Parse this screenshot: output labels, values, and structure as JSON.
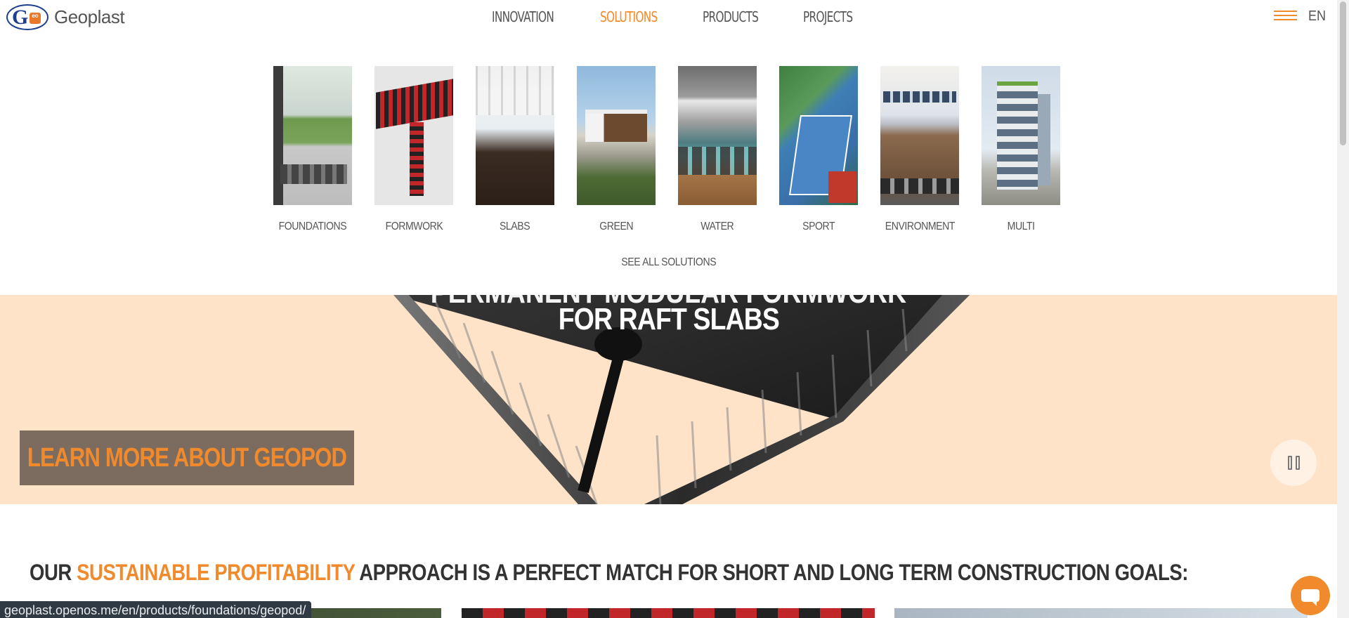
{
  "brand": {
    "name": "Geoplast",
    "logo_letters": "G",
    "logo_badge": "eo"
  },
  "nav": {
    "items": [
      {
        "label": "INNOVATION",
        "active": false
      },
      {
        "label": "SOLUTIONS",
        "active": true
      },
      {
        "label": "PRODUCTS",
        "active": false
      },
      {
        "label": "PROJECTS",
        "active": false
      }
    ],
    "language": "EN"
  },
  "solutions_menu": {
    "items": [
      {
        "label": "FOUNDATIONS"
      },
      {
        "label": "FORMWORK"
      },
      {
        "label": "SLABS"
      },
      {
        "label": "GREEN"
      },
      {
        "label": "WATER"
      },
      {
        "label": "SPORT"
      },
      {
        "label": "ENVIRONMENT"
      },
      {
        "label": "MULTI"
      }
    ],
    "see_all": "SEE ALL SOLUTIONS"
  },
  "hero": {
    "title_line_hidden": "PERMANENT MODULAR FORMWORK",
    "title_line": "FOR RAFT SLABS",
    "cta_label": "LEARN MORE ABOUT GEOPOD"
  },
  "tagline": {
    "prefix": "OUR ",
    "highlight": "SUSTAINABLE PROFITABILITY",
    "suffix": " APPROACH IS A PERFECT MATCH FOR SHORT AND LONG TERM CONSTRUCTION GOALS:"
  },
  "status_bar": {
    "url": "geoplast.openos.me/en/products/foundations/geopod/"
  },
  "colors": {
    "accent": "#f08a2c",
    "text": "#555555",
    "hero_bg": "#ffe3c8",
    "cta_bg": "#7c6c60"
  }
}
